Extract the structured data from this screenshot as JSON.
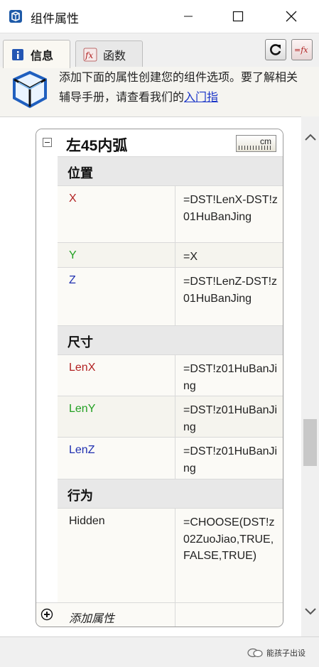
{
  "window": {
    "title": "组件属性",
    "icons": {
      "app": "sketchup-icon",
      "minimize": "minimize-icon",
      "maximize": "maximize-icon",
      "close": "close-icon"
    }
  },
  "tabs": [
    {
      "label": "信息",
      "icon": "info-icon",
      "active": true
    },
    {
      "label": "函数",
      "icon": "fx-icon",
      "active": false
    }
  ],
  "toolbar": {
    "refresh_icon": "refresh-icon",
    "formula_icon": "fx-toggle-icon"
  },
  "banner": {
    "text": "添加下面的属性创建您的组件选项。要了解相关辅导手册，请查看我们的",
    "link": "入门指"
  },
  "component": {
    "name": "左45内弧",
    "unit": "cm",
    "groups": [
      {
        "title": "位置",
        "rows": [
          {
            "key": "X",
            "value": "=DST!LenX-DST!z01HuBanJing",
            "color": "#b22222"
          },
          {
            "key": "Y",
            "value": "=X",
            "color": "#22a022"
          },
          {
            "key": "Z",
            "value": "=DST!LenZ-DST!z01HuBanJing",
            "color": "#1f2fb0"
          }
        ]
      },
      {
        "title": "尺寸",
        "rows": [
          {
            "key": "LenX",
            "value": "=DST!z01HuBanJing",
            "color": "#b22222"
          },
          {
            "key": "LenY",
            "value": "=DST!z01HuBanJing",
            "color": "#22a022"
          },
          {
            "key": "LenZ",
            "value": "=DST!z01HuBanJing",
            "color": "#1f2fb0"
          }
        ]
      },
      {
        "title": "行为",
        "rows": [
          {
            "key": "Hidden",
            "value": "=CHOOSE(DST!z02ZuoJiao,TRUE,FALSE,TRUE)",
            "color": "#222222"
          }
        ]
      }
    ],
    "add_attribute": "添加属性"
  },
  "watermark": "能孩子出设"
}
